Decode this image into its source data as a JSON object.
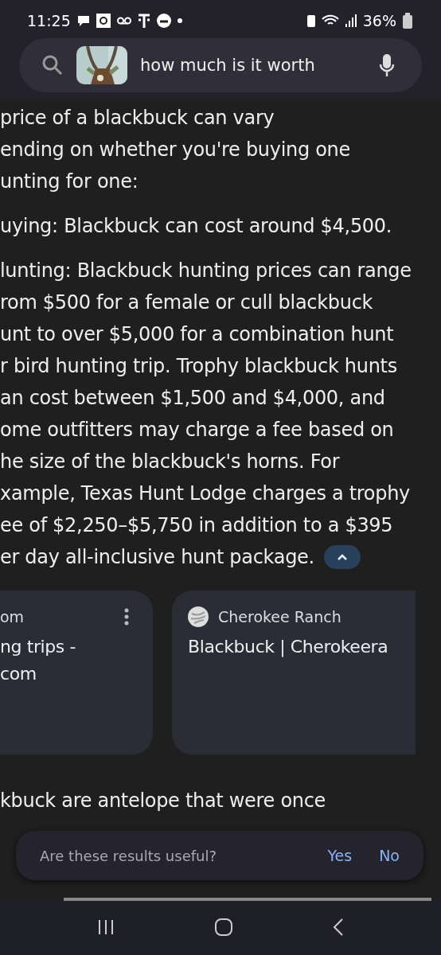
{
  "status_bar": {
    "time": "11:25",
    "battery": "36%"
  },
  "search": {
    "query": "how much is it worth"
  },
  "answer": [
    {
      "lines": [
        "price of a blackbuck can vary",
        "ending on whether you're buying one",
        "unting for one:"
      ]
    },
    {
      "lines": [
        "uying: Blackbuck can cost around $4,500."
      ]
    },
    {
      "lines": [
        "lunting: Blackbuck hunting prices can range",
        "rom $500 for a female or cull blackbuck",
        "unt to over $5,000 for a combination hunt",
        "r bird hunting trip. Trophy blackbuck hunts",
        "an cost between $1,500 and $4,000, and",
        "ome outfitters may charge a fee based on",
        "he size of the blackbuck's horns. For",
        "xample, Texas Hunt Lodge charges a trophy",
        "ee of $2,250–$5,750 in addition to a $395",
        "er day all-inclusive hunt package."
      ]
    }
  ],
  "sources": [
    {
      "source": "om",
      "title_lines": [
        "ng trips -",
        "com"
      ],
      "has_menu": true,
      "has_favicon": false
    },
    {
      "source": "Cherokee Ranch",
      "title_lines": [
        "Blackbuck | Cherokeera"
      ],
      "has_menu": false,
      "has_favicon": true
    }
  ],
  "next_paragraph": [
    "kbuck are antelope that were once"
  ],
  "feedback": {
    "question": "Are these results useful?",
    "buttons": [
      "Yes",
      "No"
    ]
  }
}
